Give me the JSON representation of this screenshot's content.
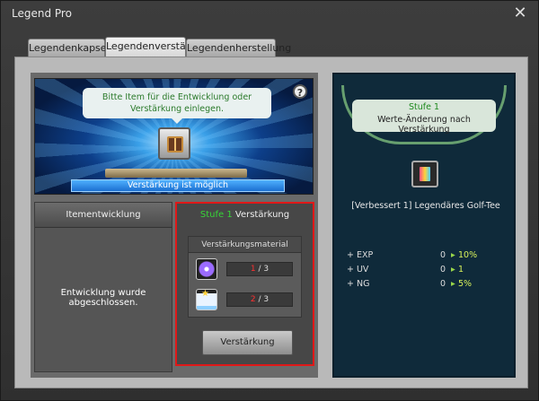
{
  "window": {
    "title": "Legend Pro",
    "close_label": "✕"
  },
  "tabs": [
    {
      "label": "Legendenkapsel"
    },
    {
      "label": "Legendenverstärkung"
    },
    {
      "label": "Legendenherstellung"
    }
  ],
  "scene": {
    "hint": "Bitte Item für die Entwicklung oder Verstärkung einlegen.",
    "help_label": "?",
    "status": "Verstärkung ist möglich"
  },
  "development": {
    "header": "Itementwicklung",
    "message": "Entwicklung wurde abgeschlossen."
  },
  "enhancement": {
    "stage": "Stufe 1",
    "header": "Verstärkung",
    "material_header": "Verstärkungsmaterial",
    "materials": [
      {
        "icon": "purple-crystal-icon",
        "have": "1",
        "need": "/ 3"
      },
      {
        "icon": "star-powder-icon",
        "have": "2",
        "need": "/ 3"
      }
    ],
    "button_label": "Verstärkung"
  },
  "result": {
    "stage": "Stufe 1",
    "caption": "Werte-Änderung nach Verstärkung",
    "item_name": "[Verbessert 1] Legendäres Golf-Tee",
    "stats": [
      {
        "label": "+ EXP",
        "from": "0",
        "to": "10%"
      },
      {
        "label": "+ UV",
        "from": "0",
        "to": "1"
      },
      {
        "label": "+ NG",
        "from": "0",
        "to": "5%"
      }
    ]
  },
  "colors": {
    "accent_green": "#37d537",
    "alert_red": "#e01818",
    "status_blue": "#1b6fd0"
  }
}
